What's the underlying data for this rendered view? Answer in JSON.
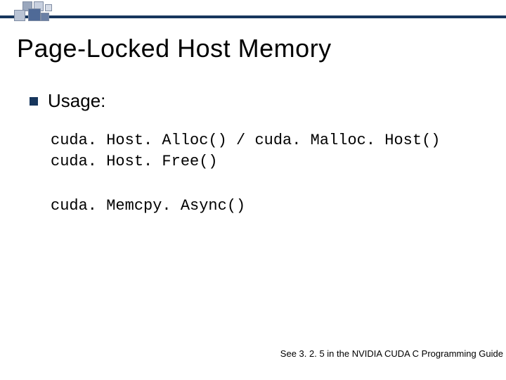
{
  "title": "Page-Locked Host Memory",
  "bullet": "Usage:",
  "code": {
    "line1": "cuda. Host. Alloc() / cuda. Malloc. Host()",
    "line2": "cuda. Host. Free()",
    "line3": "cuda. Memcpy. Async()"
  },
  "footnote": "See 3. 2. 5 in the NVIDIA CUDA C Programming Guide",
  "colors": {
    "accent": "#17365d"
  }
}
